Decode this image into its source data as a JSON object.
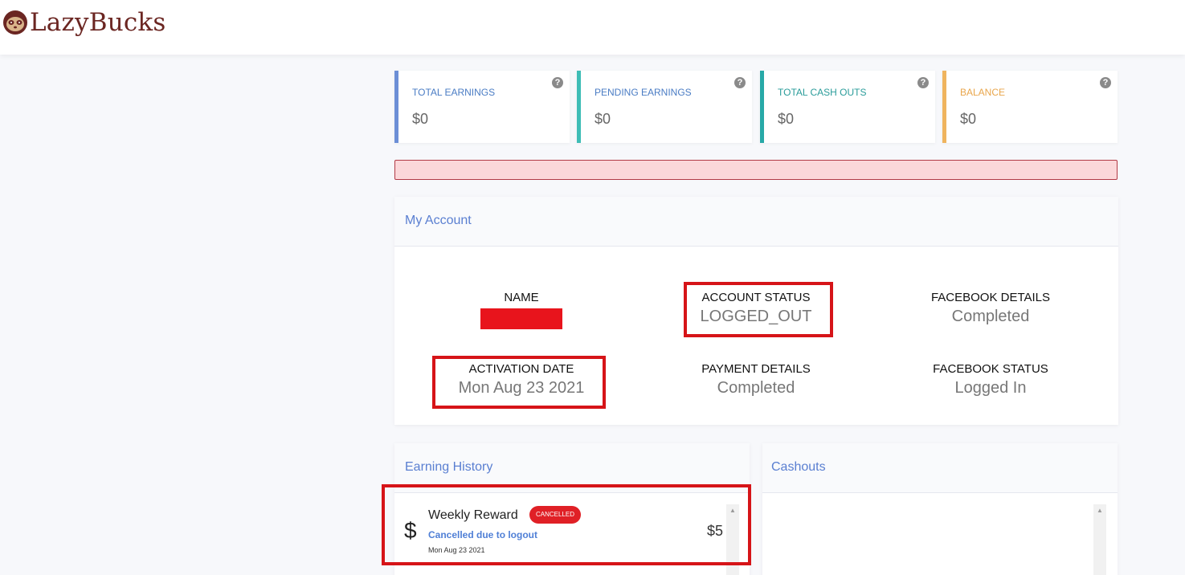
{
  "brand": {
    "name": "LazyBucks",
    "logo_color": "#6b2622"
  },
  "stats": [
    {
      "label": "TOTAL EARNINGS",
      "value": "$0",
      "color": "#6c8fd6"
    },
    {
      "label": "PENDING EARNINGS",
      "value": "$0",
      "color": "#3ebdb6"
    },
    {
      "label": "TOTAL CASH OUTS",
      "value": "$0",
      "color": "#27a9a7"
    },
    {
      "label": "BALANCE",
      "value": "$0",
      "color": "#efb45e"
    }
  ],
  "help_icon": "question-circle-icon",
  "account": {
    "title": "My Account",
    "fields": {
      "name": {
        "label": "NAME",
        "value": ""
      },
      "account_status": {
        "label": "ACCOUNT STATUS",
        "value": "LOGGED_OUT"
      },
      "facebook_details": {
        "label": "FACEBOOK DETAILS",
        "value": "Completed"
      },
      "activation_date": {
        "label": "ACTIVATION DATE",
        "value": "Mon Aug 23 2021"
      },
      "payment_details": {
        "label": "PAYMENT DETAILS",
        "value": "Completed"
      },
      "facebook_status": {
        "label": "FACEBOOK STATUS",
        "value": "Logged In"
      }
    }
  },
  "earning_history": {
    "title": "Earning History",
    "items": [
      {
        "icon": "dollar-icon",
        "symbol": "$",
        "title": "Weekly Reward",
        "badge": "CANCELLED",
        "subtitle": "Cancelled due to logout",
        "date": "Mon Aug 23 2021",
        "amount": "$5"
      }
    ]
  },
  "cashouts": {
    "title": "Cashouts"
  },
  "colors": {
    "accent": "#5a7fd1",
    "highlight": "#d61418",
    "alert_bg": "#fbd7d9",
    "alert_border": "#b23a45",
    "badge": "#e02026"
  }
}
